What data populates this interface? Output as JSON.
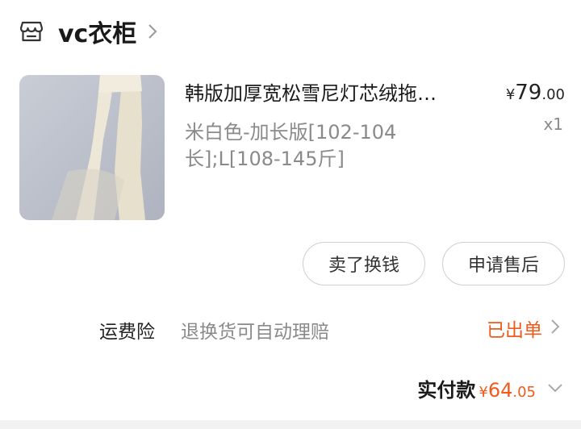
{
  "shop": {
    "name": "vc衣柜",
    "icon": "store-icon"
  },
  "item": {
    "title": "韩版加厚宽松雪尼灯芯绒拖…",
    "price": {
      "currency": "¥",
      "integer": "79",
      "decimal": ".00"
    },
    "sku_line1": "米白色-加长版[102-104",
    "sku_line2": "长];L[108-145斤]",
    "quantity": "x1"
  },
  "actions": {
    "sell_label": "卖了换钱",
    "after_sale_label": "申请售后"
  },
  "insurance": {
    "label": "运费险",
    "description": "退换货可自动理赔",
    "status": "已出单"
  },
  "payment": {
    "label": "实付款",
    "currency": "¥",
    "integer": "64",
    "decimal": ".05"
  },
  "colors": {
    "accent": "#f05a1a",
    "muted": "#8a8a8a"
  }
}
